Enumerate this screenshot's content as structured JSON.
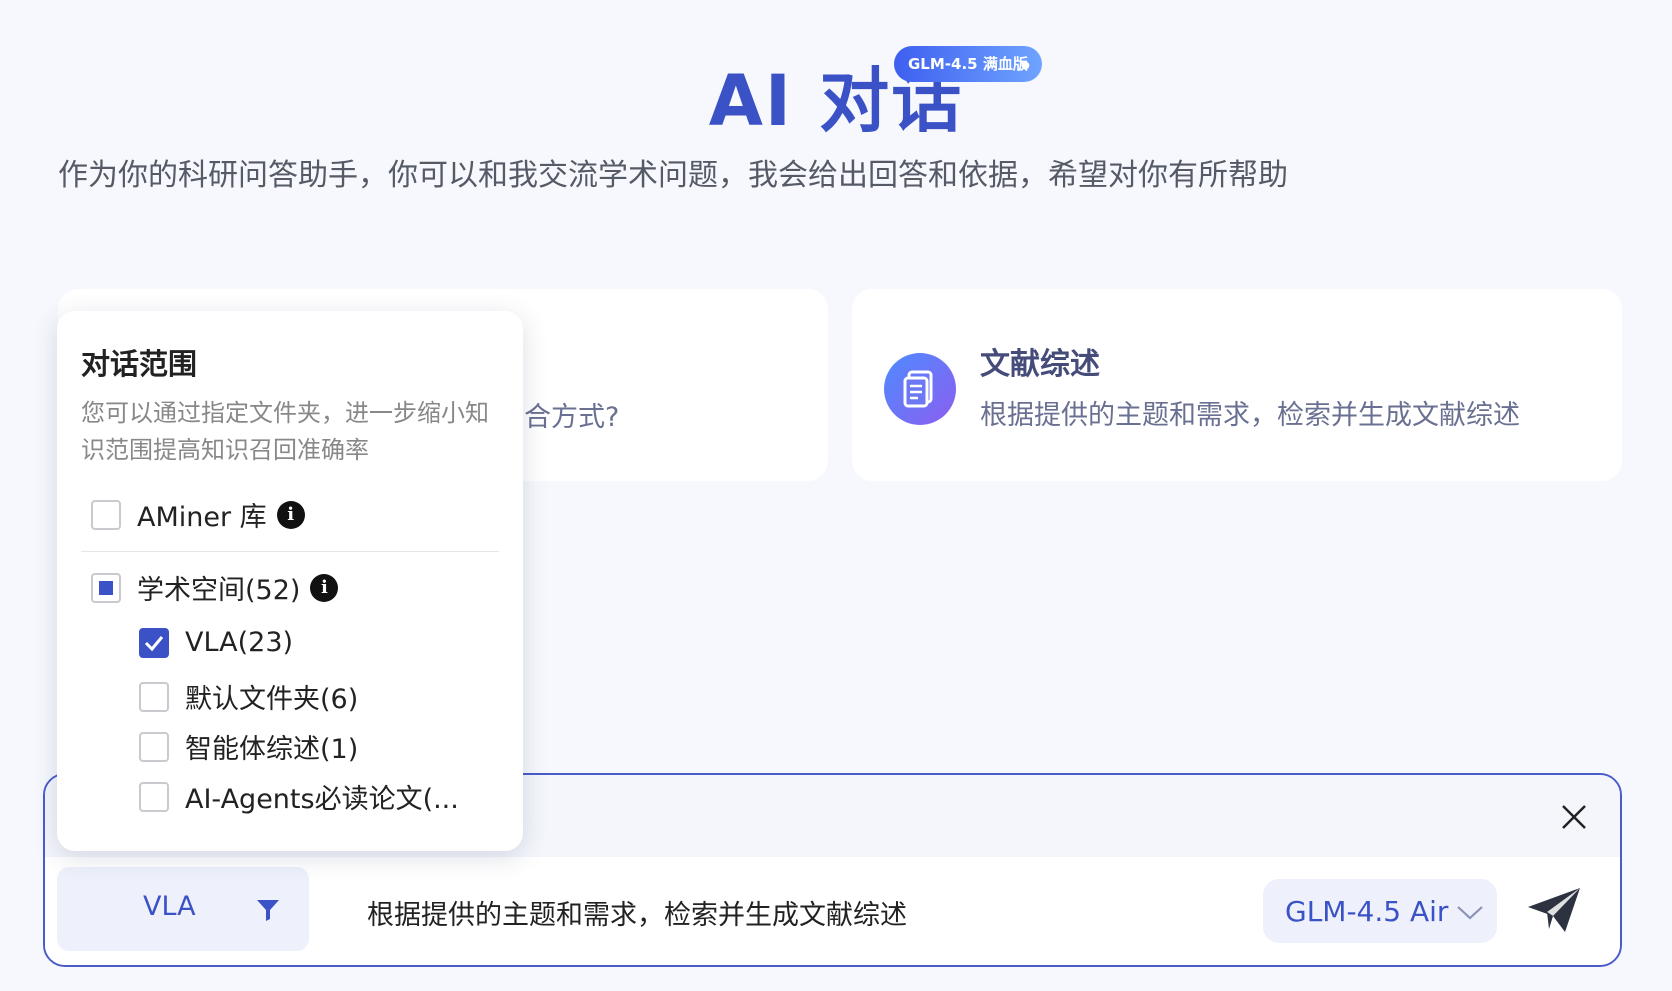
{
  "header": {
    "title": "AI 对话",
    "badge": "GLM-4.5 满血版",
    "subtitle": "作为你的科研问答助手，你可以和我交流学术问题，我会给出回答和依据，希望对你有所帮助"
  },
  "cards": {
    "left": {
      "partial_text": "合方式?"
    },
    "right": {
      "title": "文献综述",
      "desc": "根据提供的主题和需求，检索并生成文献综述",
      "icon": "document-icon"
    }
  },
  "dropdown": {
    "title": "对话范围",
    "desc": "您可以通过指定文件夹，进一步缩小知识范围提高知识召回准确率",
    "aminer": {
      "label": "AMiner 库",
      "checked": false
    },
    "space": {
      "label": "学术空间(52)",
      "state": "indeterminate"
    },
    "folders": [
      {
        "label": "VLA(23)",
        "checked": true
      },
      {
        "label": "默认文件夹(6)",
        "checked": false
      },
      {
        "label": "智能体综述(1)",
        "checked": false
      },
      {
        "label": "AI-Agents必读论文(...",
        "checked": false
      }
    ]
  },
  "input": {
    "filter_label": "VLA",
    "prompt": "根据提供的主题和需求，检索并生成文献综述",
    "model": "GLM-4.5 Air"
  },
  "footer": {
    "text": ""
  },
  "colors": {
    "accent": "#3b52c7",
    "background": "#f6f8fd"
  }
}
